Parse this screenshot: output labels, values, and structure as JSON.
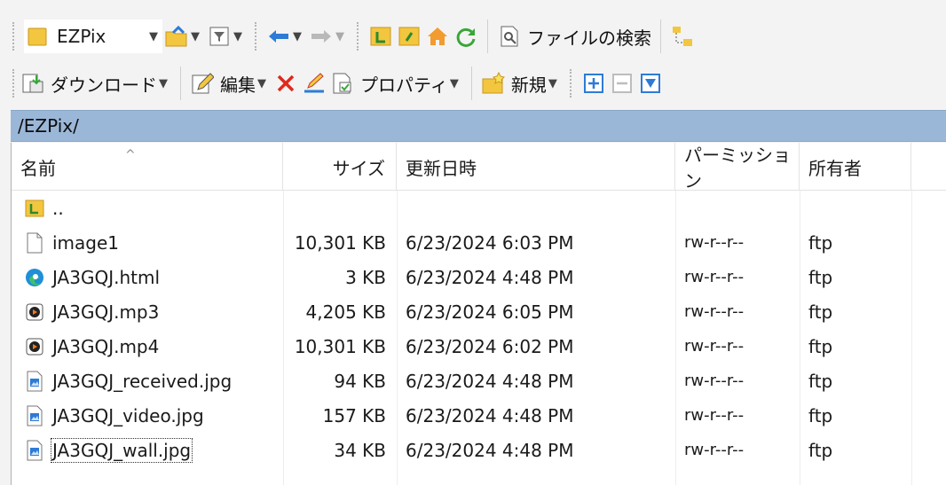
{
  "toolbar1": {
    "site_combo_value": "EZPix",
    "search_label": "ファイルの検索"
  },
  "toolbar2": {
    "download_label": "ダウンロード",
    "edit_label": "編集",
    "properties_label": "プロパティ",
    "new_label": "新規"
  },
  "path": "/EZPix/",
  "columns": {
    "name": "名前",
    "size": "サイズ",
    "modified": "更新日時",
    "permission": "パーミッション",
    "owner": "所有者"
  },
  "files": [
    {
      "name": "..",
      "size": "",
      "modified": "",
      "permission": "",
      "owner": "",
      "icon": "parent-folder-icon"
    },
    {
      "name": "image1",
      "size": "10,301 KB",
      "modified": "6/23/2024 6:03 PM",
      "permission": "rw-r--r--",
      "owner": "ftp",
      "icon": "file-icon"
    },
    {
      "name": "JA3GQJ.html",
      "size": "3 KB",
      "modified": "6/23/2024 4:48 PM",
      "permission": "rw-r--r--",
      "owner": "ftp",
      "icon": "edge-icon"
    },
    {
      "name": "JA3GQJ.mp3",
      "size": "4,205 KB",
      "modified": "6/23/2024 6:05 PM",
      "permission": "rw-r--r--",
      "owner": "ftp",
      "icon": "media-icon"
    },
    {
      "name": "JA3GQJ.mp4",
      "size": "10,301 KB",
      "modified": "6/23/2024 6:02 PM",
      "permission": "rw-r--r--",
      "owner": "ftp",
      "icon": "media-icon"
    },
    {
      "name": "JA3GQJ_received.jpg",
      "size": "94 KB",
      "modified": "6/23/2024 4:48 PM",
      "permission": "rw-r--r--",
      "owner": "ftp",
      "icon": "image-file-icon"
    },
    {
      "name": "JA3GQJ_video.jpg",
      "size": "157 KB",
      "modified": "6/23/2024 4:48 PM",
      "permission": "rw-r--r--",
      "owner": "ftp",
      "icon": "image-file-icon"
    },
    {
      "name": "JA3GQJ_wall.jpg",
      "size": "34 KB",
      "modified": "6/23/2024 4:48 PM",
      "permission": "rw-r--r--",
      "owner": "ftp",
      "icon": "image-file-icon"
    }
  ],
  "colors": {
    "path_bar": "#9bb7d8",
    "folder_yellow": "#f3c63f",
    "arrow_blue": "#2e7bd6",
    "delete_red": "#e0281b"
  }
}
